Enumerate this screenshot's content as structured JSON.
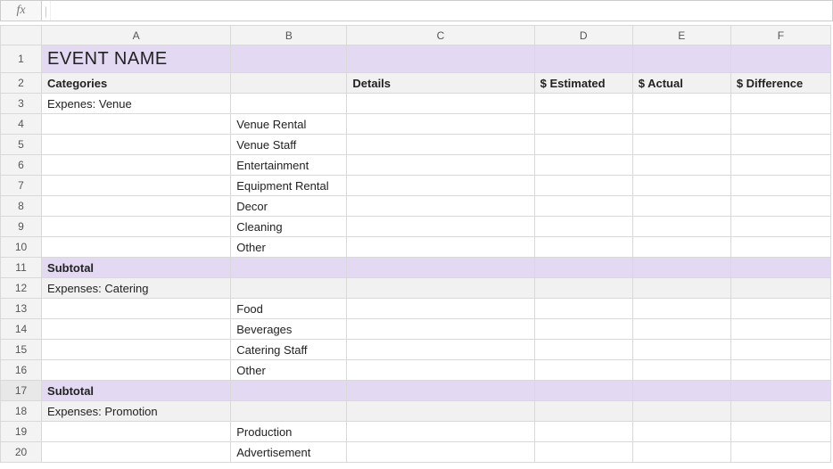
{
  "formula_bar": {
    "fx_label": "fx",
    "separator": "|",
    "value": ""
  },
  "columns": [
    "A",
    "B",
    "C",
    "D",
    "E",
    "F"
  ],
  "rows": [
    {
      "num": 1,
      "type": "title",
      "cells": {
        "A": "EVENT NAME",
        "B": "",
        "C": "",
        "D": "",
        "E": "",
        "F": ""
      }
    },
    {
      "num": 2,
      "type": "hdr",
      "cells": {
        "A": "Categories",
        "B": "",
        "C": "Details",
        "D": "$ Estimated",
        "E": "$ Actual",
        "F": "$ Difference"
      }
    },
    {
      "num": 3,
      "type": "normal",
      "cells": {
        "A": "Expenes: Venue",
        "B": "",
        "C": "",
        "D": "",
        "E": "",
        "F": ""
      }
    },
    {
      "num": 4,
      "type": "normal",
      "cells": {
        "A": "",
        "B": "Venue Rental",
        "C": "",
        "D": "",
        "E": "",
        "F": ""
      }
    },
    {
      "num": 5,
      "type": "normal",
      "cells": {
        "A": "",
        "B": "Venue Staff",
        "C": "",
        "D": "",
        "E": "",
        "F": ""
      }
    },
    {
      "num": 6,
      "type": "normal",
      "cells": {
        "A": "",
        "B": "Entertainment",
        "C": "",
        "D": "",
        "E": "",
        "F": ""
      }
    },
    {
      "num": 7,
      "type": "normal",
      "cells": {
        "A": "",
        "B": "Equipment Rental",
        "C": "",
        "D": "",
        "E": "",
        "F": ""
      }
    },
    {
      "num": 8,
      "type": "normal",
      "cells": {
        "A": "",
        "B": "Decor",
        "C": "",
        "D": "",
        "E": "",
        "F": ""
      }
    },
    {
      "num": 9,
      "type": "normal",
      "cells": {
        "A": "",
        "B": "Cleaning",
        "C": "",
        "D": "",
        "E": "",
        "F": ""
      }
    },
    {
      "num": 10,
      "type": "normal",
      "cells": {
        "A": "",
        "B": "Other",
        "C": "",
        "D": "",
        "E": "",
        "F": ""
      }
    },
    {
      "num": 11,
      "type": "subtotal",
      "cells": {
        "A": "Subtotal",
        "B": "",
        "C": "",
        "D": "",
        "E": "",
        "F": ""
      }
    },
    {
      "num": 12,
      "type": "section",
      "cells": {
        "A": "Expenses: Catering",
        "B": "",
        "C": "",
        "D": "",
        "E": "",
        "F": ""
      }
    },
    {
      "num": 13,
      "type": "normal",
      "cells": {
        "A": "",
        "B": "Food",
        "C": "",
        "D": "",
        "E": "",
        "F": ""
      }
    },
    {
      "num": 14,
      "type": "normal",
      "cells": {
        "A": "",
        "B": "Beverages",
        "C": "",
        "D": "",
        "E": "",
        "F": ""
      }
    },
    {
      "num": 15,
      "type": "normal",
      "cells": {
        "A": "",
        "B": "Catering Staff",
        "C": "",
        "D": "",
        "E": "",
        "F": ""
      }
    },
    {
      "num": 16,
      "type": "normal",
      "cells": {
        "A": "",
        "B": "Other",
        "C": "",
        "D": "",
        "E": "",
        "F": ""
      }
    },
    {
      "num": 17,
      "type": "subtotal",
      "selected": true,
      "cells": {
        "A": "Subtotal",
        "B": "",
        "C": "",
        "D": "",
        "E": "",
        "F": ""
      }
    },
    {
      "num": 18,
      "type": "section",
      "cells": {
        "A": "Expenses: Promotion",
        "B": "",
        "C": "",
        "D": "",
        "E": "",
        "F": ""
      }
    },
    {
      "num": 19,
      "type": "normal",
      "cells": {
        "A": "",
        "B": "Production",
        "C": "",
        "D": "",
        "E": "",
        "F": ""
      }
    },
    {
      "num": 20,
      "type": "normal",
      "cells": {
        "A": "",
        "B": "Advertisement",
        "C": "",
        "D": "",
        "E": "",
        "F": ""
      }
    }
  ]
}
